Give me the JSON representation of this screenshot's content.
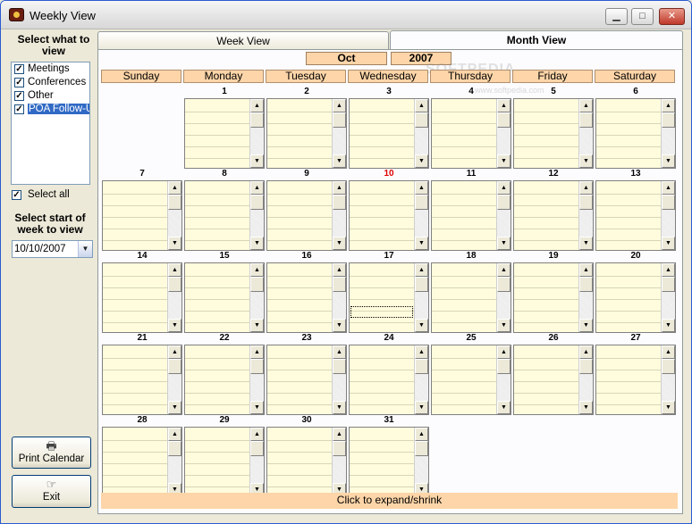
{
  "window": {
    "title": "Weekly View",
    "minimize_glyph": "▁",
    "maximize_glyph": "□",
    "close_glyph": "✕"
  },
  "sidebar": {
    "select_label": "Select what to view",
    "categories": [
      {
        "label": "Meetings",
        "checked": true,
        "selected": false
      },
      {
        "label": "Conferences",
        "checked": true,
        "selected": false
      },
      {
        "label": "Other",
        "checked": true,
        "selected": false
      },
      {
        "label": "POA Follow-Up",
        "checked": true,
        "selected": true
      }
    ],
    "select_all_label": "Select all",
    "select_all_checked": true,
    "week_start_label": "Select start of week to view",
    "week_start_value": "10/10/2007",
    "print_label": "Print Calendar",
    "exit_label": "Exit"
  },
  "tabs": {
    "week": "Week View",
    "month": "Month View",
    "active": "month"
  },
  "calendar": {
    "month": "Oct",
    "year": "2007",
    "days": [
      "Sunday",
      "Monday",
      "Tuesday",
      "Wednesday",
      "Thursday",
      "Friday",
      "Saturday"
    ],
    "first_weekday": 1,
    "days_in_month": 31,
    "today": 10,
    "focused_day": 17,
    "expand_label": "Click to expand/shrink"
  },
  "watermark": {
    "brand": "SOFTPEDIA",
    "url": "www.softpedia.com"
  },
  "colors": {
    "header_fill": "#fdd5a8",
    "cell_fill": "#fffcdd",
    "today_text": "#e00000",
    "selection": "#316ac5"
  },
  "icons": {
    "print": "printer-icon",
    "exit": "pointing-hand-icon",
    "app": "app-icon"
  }
}
